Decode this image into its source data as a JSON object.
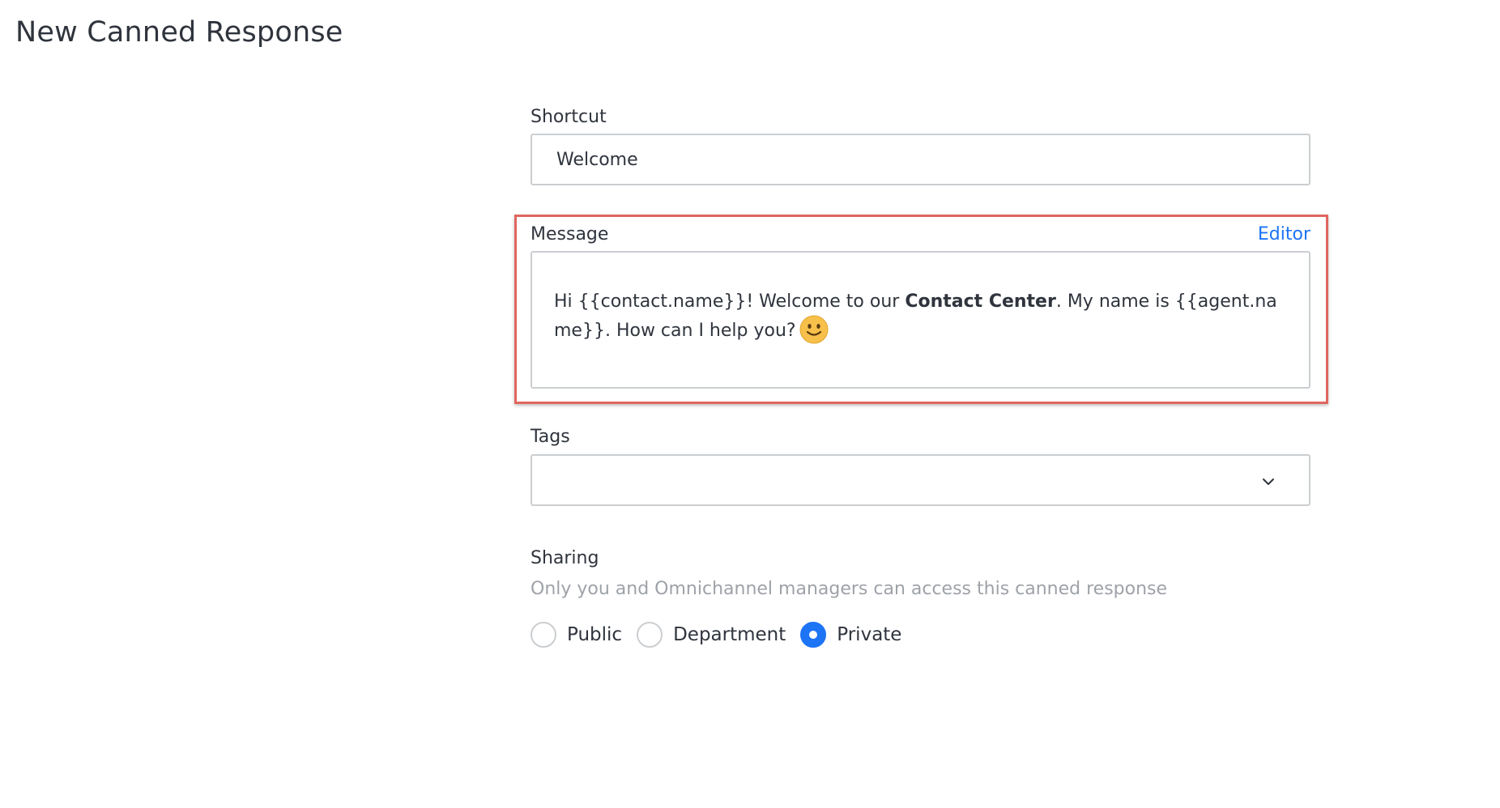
{
  "page": {
    "title": "New Canned Response"
  },
  "shortcut": {
    "label": "Shortcut",
    "value": "Welcome"
  },
  "message": {
    "label": "Message",
    "editor_link": "Editor",
    "text_before_bold": "Hi {{contact.name}}! Welcome to our ",
    "bold_text": "Contact Center",
    "text_after_bold": ". My name is {{agent.name}}. How can I help you?",
    "emoji_icon": "slightly-smiling-face-icon",
    "highlight_color": "#e0665f"
  },
  "tags": {
    "label": "Tags",
    "value": ""
  },
  "sharing": {
    "label": "Sharing",
    "hint": "Only you and Omnichannel managers can access this canned response",
    "options": [
      {
        "label": "Public",
        "checked": false
      },
      {
        "label": "Department",
        "checked": false
      },
      {
        "label": "Private",
        "checked": true
      }
    ],
    "accent_color": "#1d74f5"
  }
}
